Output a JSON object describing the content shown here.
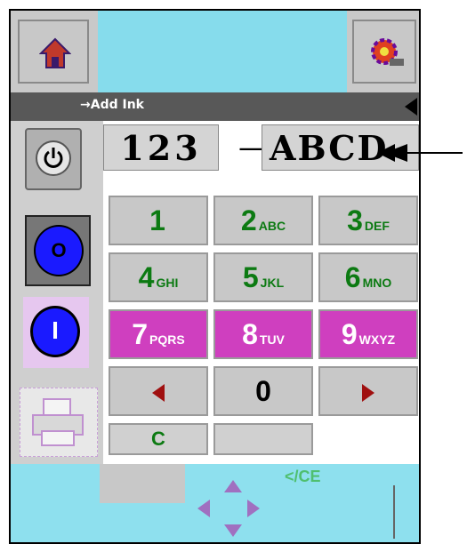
{
  "status_bar": {
    "text": "→Add Ink"
  },
  "code_display": {
    "left": "123",
    "separator": "—",
    "right": "ABCD"
  },
  "left_controls": {
    "stop_label": "O",
    "start_label": "I"
  },
  "keypad": {
    "keys": [
      {
        "digit": "1",
        "letters": ""
      },
      {
        "digit": "2",
        "letters": "ABC"
      },
      {
        "digit": "3",
        "letters": "DEF"
      },
      {
        "digit": "4",
        "letters": "GHI"
      },
      {
        "digit": "5",
        "letters": "JKL"
      },
      {
        "digit": "6",
        "letters": "MNO"
      },
      {
        "digit": "7",
        "letters": "PQRS"
      },
      {
        "digit": "8",
        "letters": "TUV"
      },
      {
        "digit": "9",
        "letters": "WXYZ"
      },
      {
        "digit": "0",
        "letters": ""
      }
    ],
    "partial_key": "C",
    "ce_label": "</CE"
  },
  "colors": {
    "banner": "#86dcec",
    "keypad_green": "#0c7a12",
    "keypad_magenta": "#cf3fbf",
    "blue_button": "#1a1aff"
  },
  "icons": [
    "home-icon",
    "settings-gear-icon",
    "power-icon",
    "printer-icon",
    "arrow-left-icon",
    "arrow-right-icon"
  ]
}
